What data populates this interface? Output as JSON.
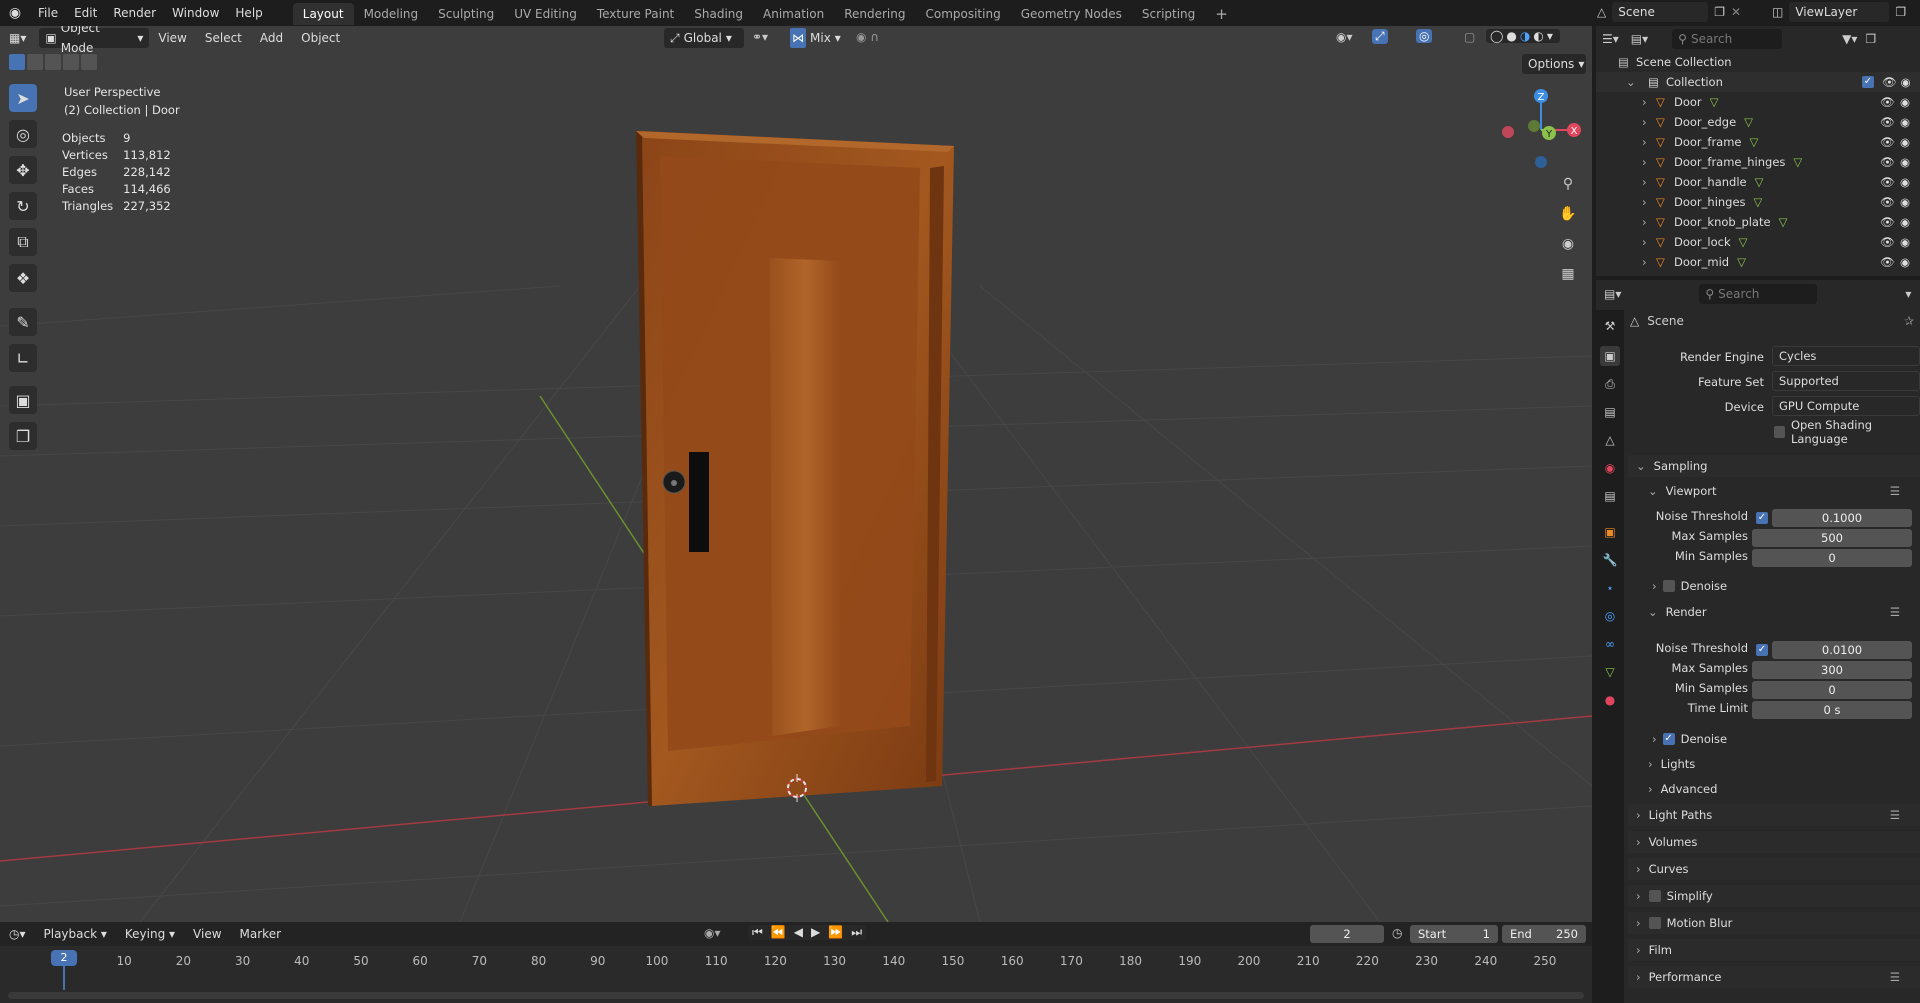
{
  "topbar": {
    "menus": [
      "File",
      "Edit",
      "Render",
      "Window",
      "Help"
    ],
    "workspaces": [
      "Layout",
      "Modeling",
      "Sculpting",
      "UV Editing",
      "Texture Paint",
      "Shading",
      "Animation",
      "Rendering",
      "Compositing",
      "Geometry Nodes",
      "Scripting"
    ],
    "active_workspace": "Layout",
    "add_tab": "+",
    "scene": "Scene",
    "view_layer": "ViewLayer"
  },
  "viewport_header": {
    "mode": "Object Mode",
    "menus": [
      "View",
      "Select",
      "Add",
      "Object"
    ],
    "orientation": "Global",
    "pivot": "Mix",
    "options": "Options"
  },
  "viewport_overlay": {
    "perspective": "User Perspective",
    "collection_path": "(2) Collection | Door",
    "stats": [
      {
        "label": "Objects",
        "value": "9"
      },
      {
        "label": "Vertices",
        "value": "113,812"
      },
      {
        "label": "Edges",
        "value": "228,142"
      },
      {
        "label": "Faces",
        "value": "114,466"
      },
      {
        "label": "Triangles",
        "value": "227,352"
      }
    ]
  },
  "gizmo": {
    "x": "X",
    "y": "Y",
    "z": "Z"
  },
  "timeline": {
    "menus": [
      "Playback",
      "Keying",
      "View",
      "Marker"
    ],
    "current_frame": "2",
    "start_label": "Start",
    "start": "1",
    "end_label": "End",
    "end": "250",
    "ticks": [
      "10",
      "20",
      "30",
      "40",
      "50",
      "60",
      "70",
      "80",
      "90",
      "100",
      "110",
      "120",
      "130",
      "140",
      "150",
      "160",
      "170",
      "180",
      "190",
      "200",
      "210",
      "220",
      "230",
      "240",
      "250"
    ],
    "playhead": "2"
  },
  "outliner": {
    "search_placeholder": "Search",
    "root": "Scene Collection",
    "collection": "Collection",
    "objects": [
      "Door",
      "Door_edge",
      "Door_frame",
      "Door_frame_hinges",
      "Door_handle",
      "Door_hinges",
      "Door_knob_plate",
      "Door_lock",
      "Door_mid"
    ]
  },
  "properties": {
    "search_placeholder": "Search",
    "context": "Scene",
    "render_engine_label": "Render Engine",
    "render_engine": "Cycles",
    "feature_set_label": "Feature Set",
    "feature_set": "Supported",
    "device_label": "Device",
    "device": "GPU Compute",
    "osl_label": "Open Shading Language",
    "sampling": "Sampling",
    "viewport": "Viewport",
    "vp_noise_label": "Noise Threshold",
    "vp_noise": "0.1000",
    "vp_max_label": "Max Samples",
    "vp_max": "500",
    "vp_min_label": "Min Samples",
    "vp_min": "0",
    "vp_denoise": "Denoise",
    "render": "Render",
    "r_noise_label": "Noise Threshold",
    "r_noise": "0.0100",
    "r_max_label": "Max Samples",
    "r_max": "300",
    "r_min_label": "Min Samples",
    "r_min": "0",
    "r_time_label": "Time Limit",
    "r_time": "0 s",
    "r_denoise": "Denoise",
    "lights": "Lights",
    "advanced": "Advanced",
    "light_paths": "Light Paths",
    "volumes": "Volumes",
    "curves": "Curves",
    "simplify": "Simplify",
    "motion_blur": "Motion Blur",
    "film": "Film",
    "performance": "Performance"
  },
  "colors": {
    "accent": "#4772b3",
    "x_axis": "#e0465e",
    "y_axis": "#8bc34a",
    "z_axis": "#3d8ee3",
    "door": "#9a4e1c"
  }
}
